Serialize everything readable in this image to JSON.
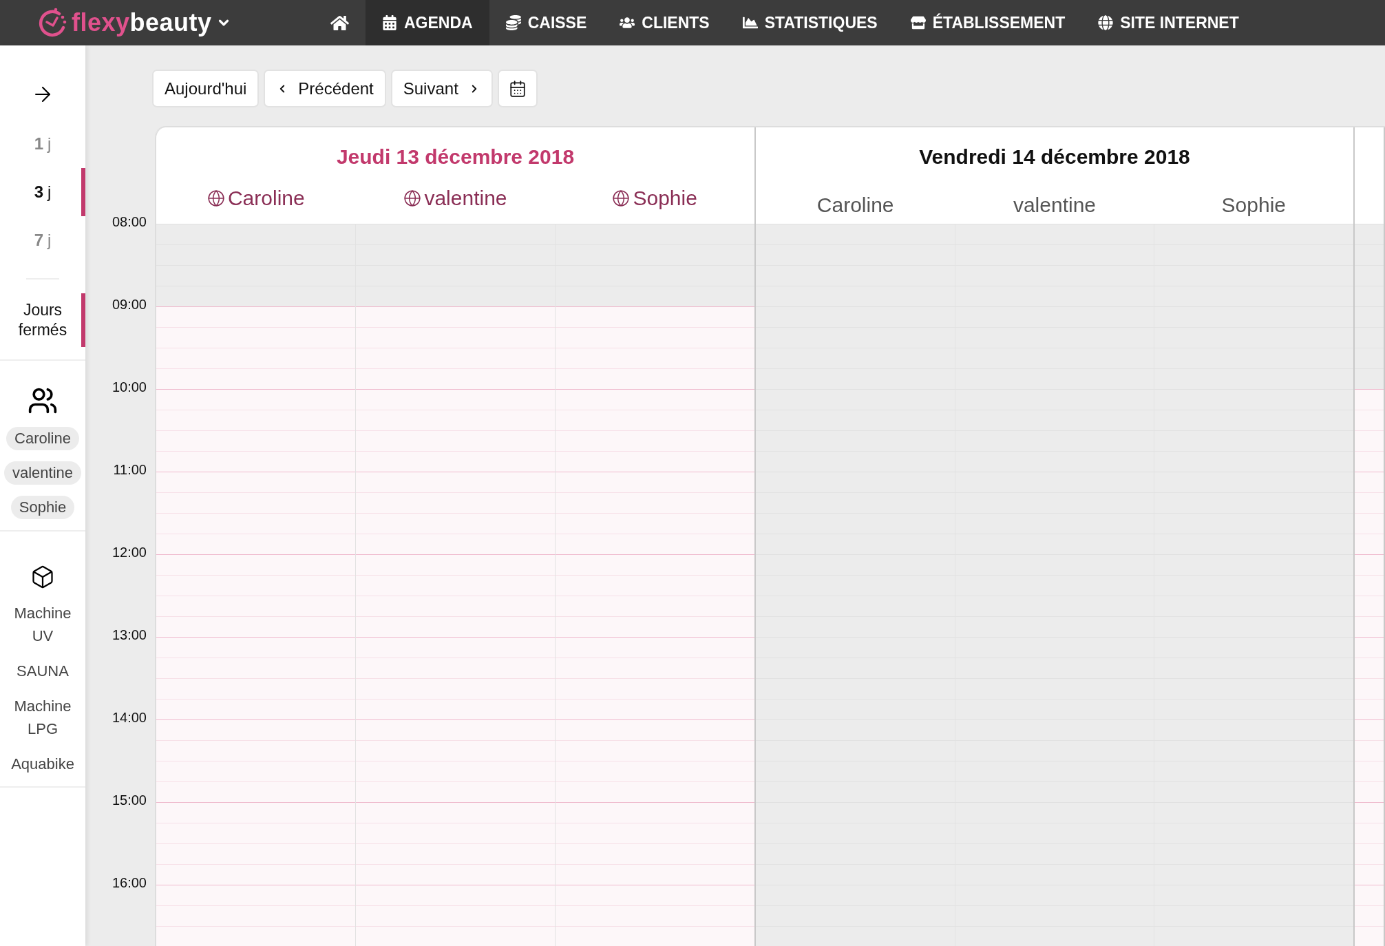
{
  "brand": {
    "part_1": "flexy",
    "part_2": "beauty"
  },
  "nav": [
    {
      "kind": "home",
      "selected": false
    },
    {
      "kind": "agenda",
      "label": "AGENDA",
      "selected": true
    },
    {
      "kind": "cash",
      "label": "CAISSE",
      "selected": false
    },
    {
      "kind": "clients",
      "label": "CLIENTS",
      "selected": false
    },
    {
      "kind": "stats",
      "label": "STATISTIQUES",
      "selected": false
    },
    {
      "kind": "shop",
      "label": "ÉTABLISSEMENT",
      "selected": false
    },
    {
      "kind": "web",
      "label": "SITE INTERNET",
      "selected": false
    }
  ],
  "sidebar": {
    "views": [
      {
        "number": "1",
        "unit": "j",
        "selected": false
      },
      {
        "number": "3",
        "unit": "j",
        "selected": true
      },
      {
        "number": "7",
        "unit": "j",
        "selected": false
      }
    ],
    "closed_days": {
      "label": "Jours fermés",
      "selected": true
    },
    "staff": [
      "Caroline",
      "valentine",
      "Sophie"
    ],
    "resources": [
      "Machine UV",
      "SAUNA",
      "Machine LPG",
      "Aquabike"
    ]
  },
  "toolbar": {
    "today": "Aujourd'hui",
    "previous": "Précédent",
    "next": "Suivant"
  },
  "times": [
    "08:00",
    "09:00",
    "10:00",
    "11:00",
    "12:00",
    "13:00",
    "14:00",
    "15:00",
    "16:00"
  ],
  "days": [
    {
      "title": "Jeudi 13 décembre 2018",
      "today": true,
      "staff": [
        "Caroline",
        "valentine",
        "Sophie"
      ],
      "hours": [
        {
          "closed": true
        },
        {
          "closed": false
        },
        {
          "closed": false
        },
        {
          "closed": false
        },
        {
          "closed": false
        },
        {
          "closed": false
        },
        {
          "closed": false
        },
        {
          "closed": false
        },
        {
          "closed": false
        }
      ]
    },
    {
      "title": "Vendredi 14 décembre 2018",
      "today": false,
      "staff": [
        "Caroline",
        "valentine",
        "Sophie"
      ],
      "hours": [
        {
          "closed": true
        },
        {
          "closed": true
        },
        {
          "closed": true
        },
        {
          "closed": true
        },
        {
          "closed": true
        },
        {
          "closed": true
        },
        {
          "closed": true
        },
        {
          "closed": true
        },
        {
          "closed": true
        }
      ]
    },
    {
      "hours": [
        {
          "closed": true
        },
        {
          "closed": true
        },
        {
          "closed": false
        },
        {
          "closed": false
        },
        {
          "closed": false
        },
        {
          "closed": false
        },
        {
          "closed": false
        },
        {
          "closed": false
        },
        {
          "closed": false
        }
      ]
    }
  ]
}
